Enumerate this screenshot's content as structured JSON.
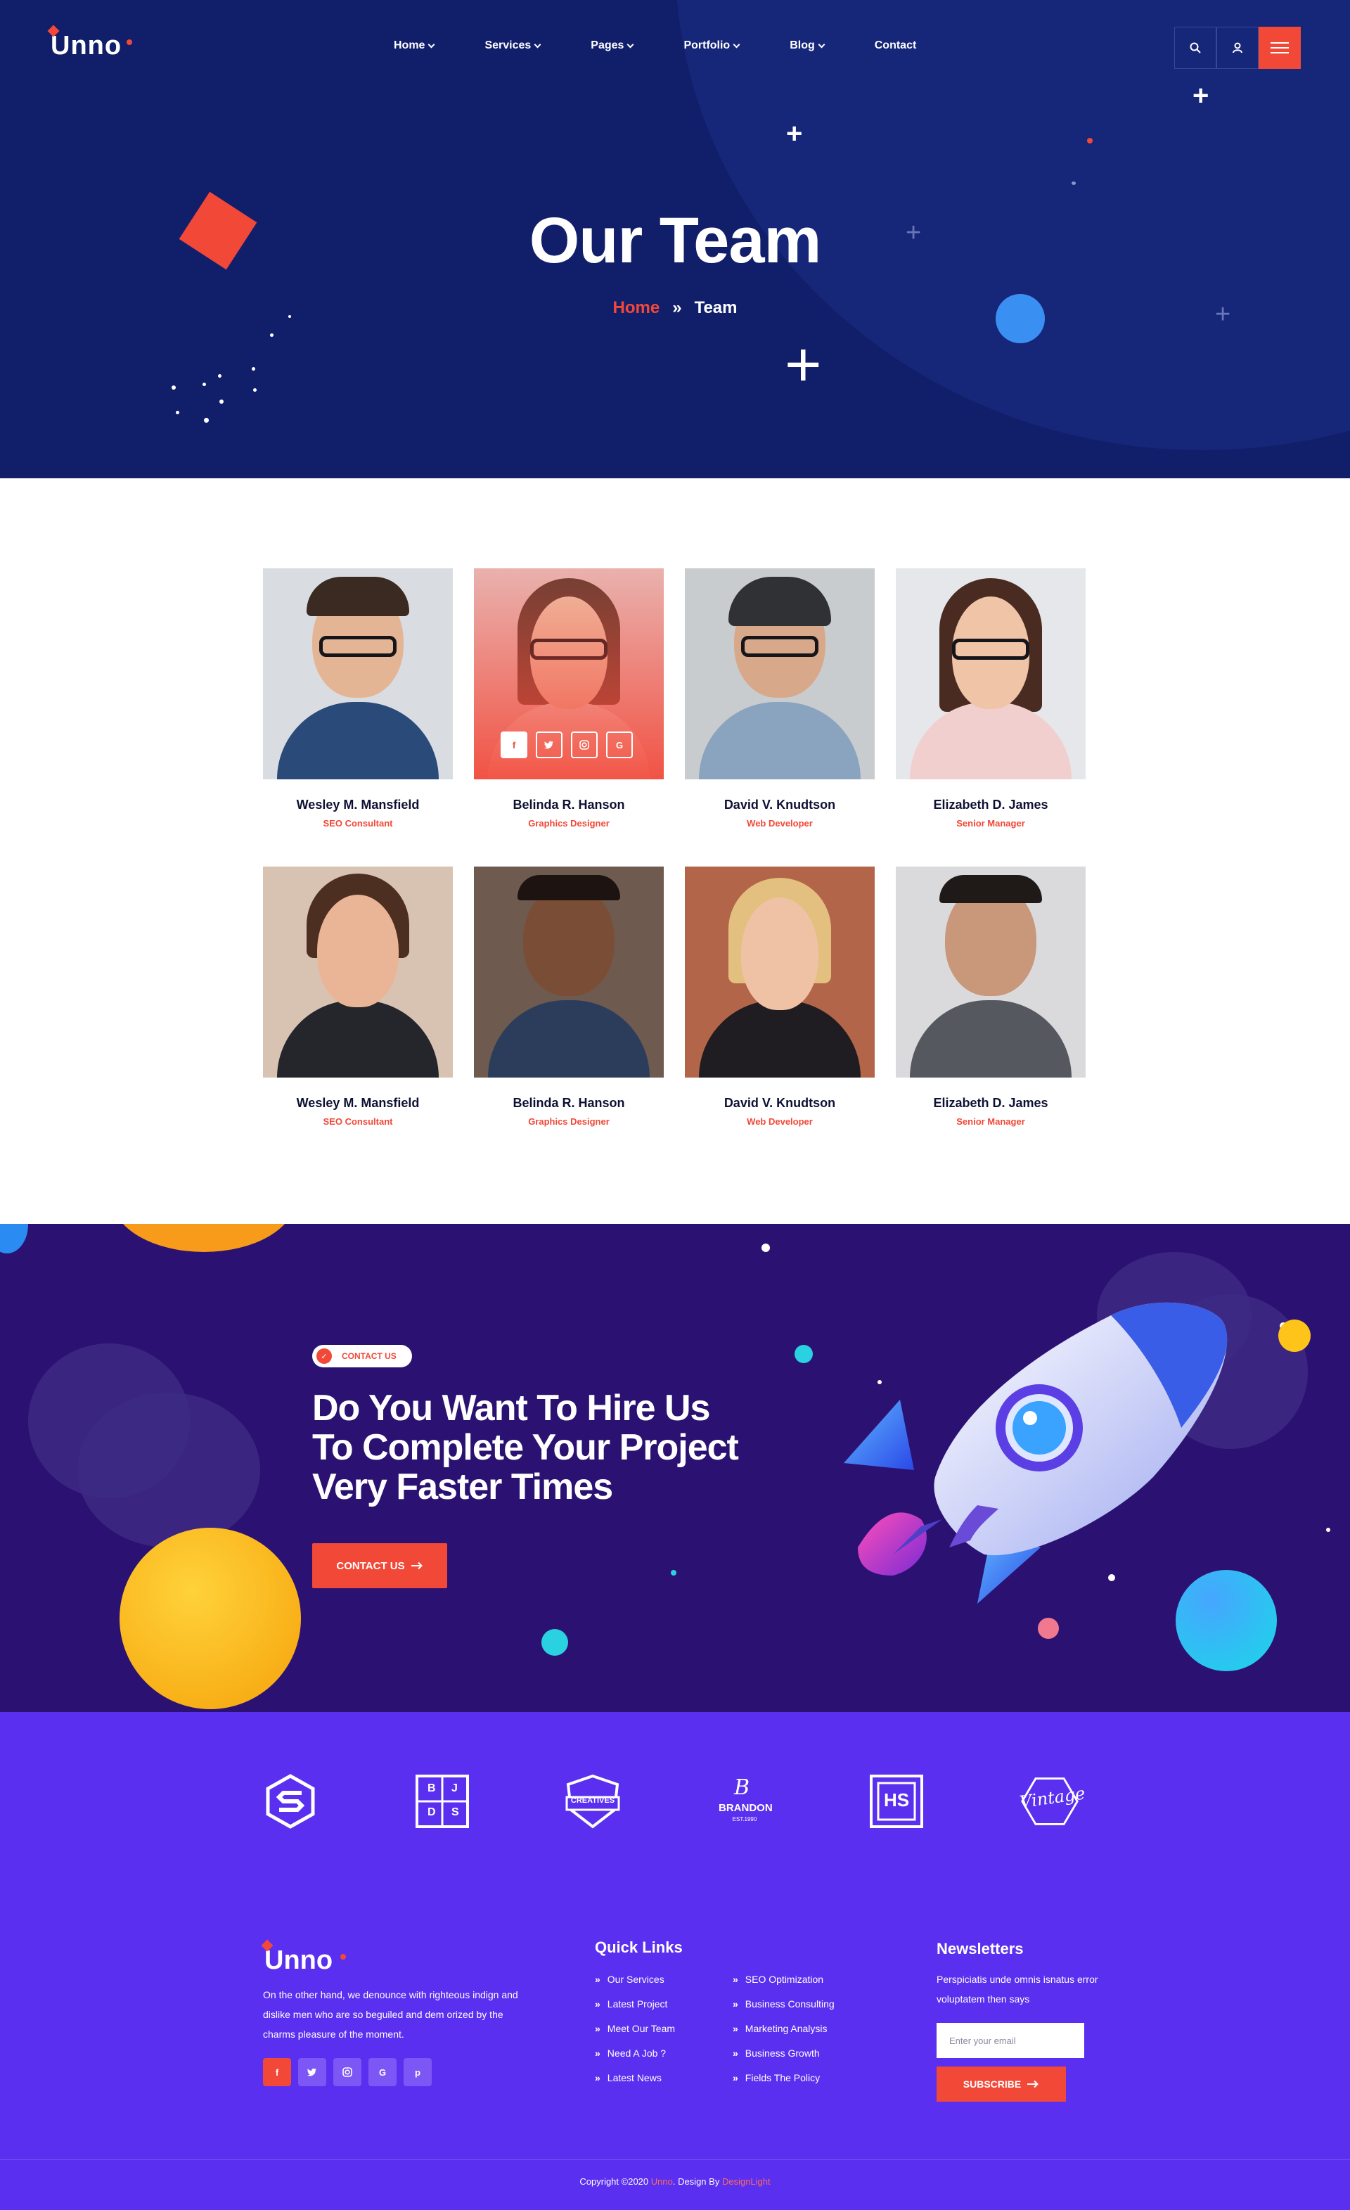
{
  "brand": {
    "name": "Unno"
  },
  "nav": {
    "items": [
      {
        "label": "Home",
        "has_dropdown": true
      },
      {
        "label": "Services",
        "has_dropdown": true
      },
      {
        "label": "Pages",
        "has_dropdown": true
      },
      {
        "label": "Portfolio",
        "has_dropdown": true
      },
      {
        "label": "Blog",
        "has_dropdown": true
      },
      {
        "label": "Contact",
        "has_dropdown": false
      }
    ],
    "icons": [
      "search-icon",
      "user-icon",
      "menu-icon"
    ]
  },
  "hero": {
    "title": "Our Team",
    "breadcrumb": {
      "home": "Home",
      "separator": "»",
      "current": "Team"
    }
  },
  "team": {
    "members": [
      {
        "name": "Wesley M. Mansfield",
        "role": "SEO Consultant"
      },
      {
        "name": "Belinda R. Hanson",
        "role": "Graphics Designer",
        "social": [
          "f",
          "t",
          "o",
          "G"
        ]
      },
      {
        "name": "David V. Knudtson",
        "role": "Web Developer"
      },
      {
        "name": "Elizabeth D. James",
        "role": "Senior Manager"
      },
      {
        "name": "Wesley M. Mansfield",
        "role": "SEO Consultant"
      },
      {
        "name": "Belinda R. Hanson",
        "role": "Graphics Designer"
      },
      {
        "name": "David V. Knudtson",
        "role": "Web Developer"
      },
      {
        "name": "Elizabeth D. James",
        "role": "Senior Manager"
      }
    ]
  },
  "cta": {
    "badge": "CONTACT US",
    "title_line1": "Do You Want To Hire Us",
    "title_line2": "To Complete Your Project",
    "title_line3": "Very Faster Times",
    "button": "CONTACT US"
  },
  "brands": {
    "logos": [
      {
        "icon": "s-hexagon-logo"
      },
      {
        "icon": "bjds-logo",
        "text": "B J D S"
      },
      {
        "icon": "creatives-badge-logo",
        "text": "CREATIVES"
      },
      {
        "icon": "brandon-logo",
        "text": "BRANDON",
        "sub": "EST.1990"
      },
      {
        "icon": "hs-logo",
        "text": "HS"
      },
      {
        "icon": "vintage-logo",
        "text": "Vintage"
      }
    ]
  },
  "footer": {
    "about": "On the other hand, we denounce with righteous indign and dislike men who are so beguiled and dem orized by the charms pleasure of the moment.",
    "social": [
      "f",
      "t",
      "o",
      "G",
      "p"
    ],
    "quick_links_title": "Quick Links",
    "links_col1": [
      "Our Services",
      "Latest Project",
      "Meet Our Team",
      "Need A Job ?",
      "Latest News"
    ],
    "links_col2": [
      "SEO Optimization",
      "Business Consulting",
      "Marketing Analysis",
      "Business Growth",
      "Fields The Policy"
    ],
    "newsletter_title": "Newsletters",
    "newsletter_text": "Perspiciatis unde omnis isnatus error voluptatem then says",
    "email_placeholder": "Enter your email",
    "subscribe": "SUBSCRIBE",
    "copyright_prefix": "Copyright ©2020",
    "copyright_brand": "Unno",
    "copyright_mid": ". Design By",
    "copyright_author": "DesignLight"
  },
  "colors": {
    "accent": "#f24838",
    "hero_bg": "#111f6b",
    "cta_bg": "#2b1272",
    "footer_bg": "#5a2ff0"
  }
}
